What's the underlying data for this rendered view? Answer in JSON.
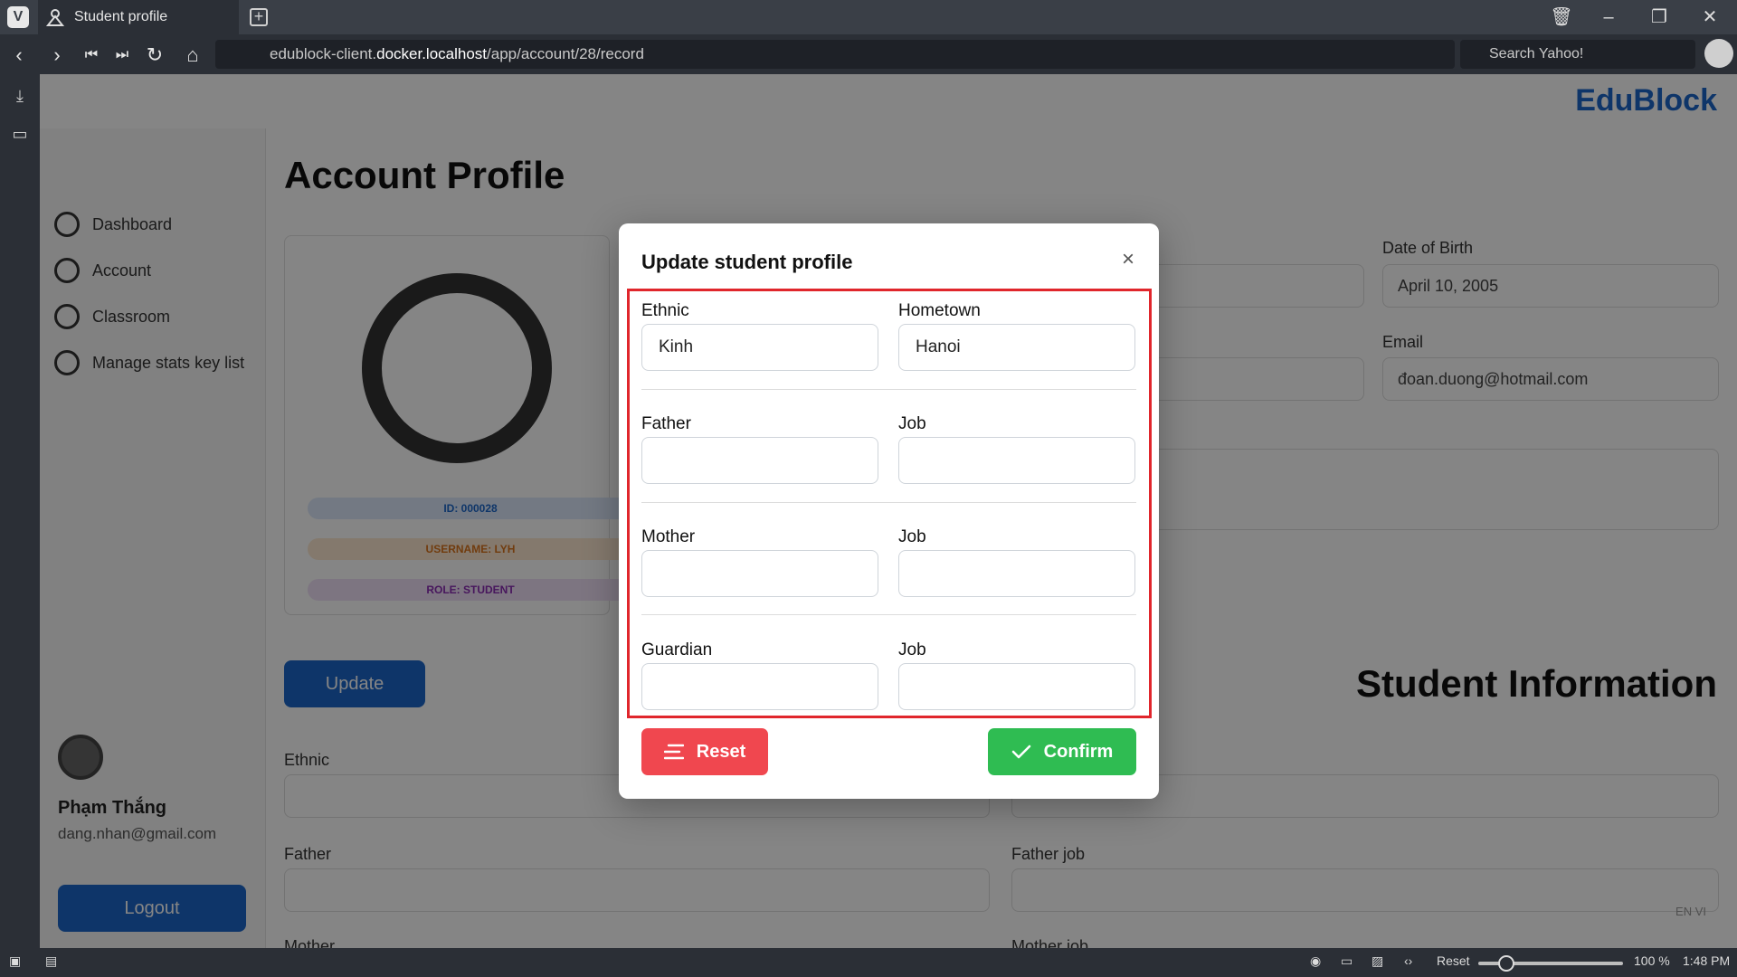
{
  "browser": {
    "tab_title": "Student profile",
    "url_prefix": "edublock-client.",
    "url_host": "docker.localhost",
    "url_path": "/app/account/28/record",
    "search_placeholder": "Search Yahoo!"
  },
  "app": {
    "brand": "EduBlock",
    "nav": [
      "Dashboard",
      "Account",
      "Classroom",
      "Manage stats key list"
    ],
    "page_title": "Account Profile",
    "badges": [
      "ID: 000028",
      "USERNAME: LYH",
      "ROLE: STUDENT"
    ],
    "update_label": "Update",
    "user_name": "Phạm Thắng",
    "user_email": "dang.nhan@gmail.com",
    "logout_label": "Logout",
    "dob_label": "Date of Birth",
    "dob_value": "April 10, 2005",
    "email_label": "Email",
    "email_value": "đoan.duong@hotmail.com",
    "student_info_title": "Student Information",
    "bg_fields": [
      "Ethnic",
      "Father",
      "Father job",
      "Mother",
      "Mother job"
    ],
    "lang": "EN  VI"
  },
  "modal": {
    "title": "Update student profile",
    "close": "×",
    "fields": {
      "ethnic_label": "Ethnic",
      "ethnic_value": "Kinh",
      "hometown_label": "Hometown",
      "hometown_value": "Hanoi",
      "father_label": "Father",
      "father_value": "",
      "father_job_label": "Job",
      "father_job_value": "",
      "mother_label": "Mother",
      "mother_value": "",
      "mother_job_label": "Job",
      "mother_job_value": "",
      "guardian_label": "Guardian",
      "guardian_value": "",
      "guardian_job_label": "Job",
      "guardian_job_value": ""
    },
    "reset_label": "Reset",
    "confirm_label": "Confirm"
  },
  "status": {
    "reset": "Reset",
    "zoom": "100 %",
    "time": "1:48 PM"
  }
}
